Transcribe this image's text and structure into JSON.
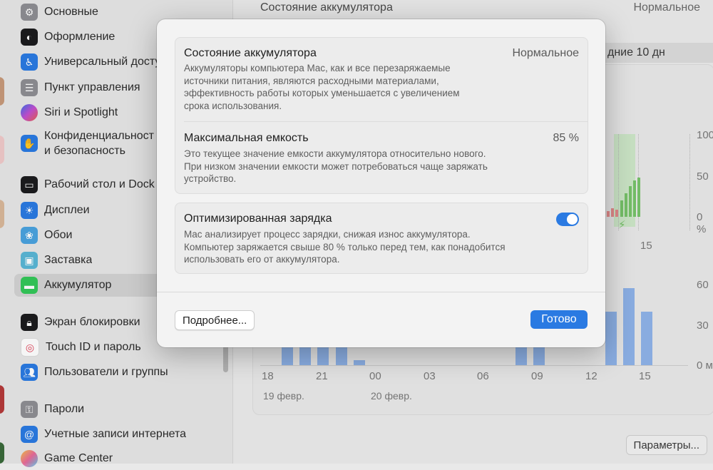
{
  "sidebar": {
    "items": [
      {
        "label": "Основные",
        "icon": "gear-icon",
        "color": "#8e8e93"
      },
      {
        "label": "Оформление",
        "icon": "appearance-icon",
        "color": "#1c1c1e"
      },
      {
        "label": "Универсальный доступ",
        "icon": "accessibility-icon",
        "color": "#2a7ae2"
      },
      {
        "label": "Пункт управления",
        "icon": "control-center-icon",
        "color": "#8e8e93"
      },
      {
        "label": "Siri и Spotlight",
        "icon": "siri-icon",
        "color": "#6a4fd1"
      },
      {
        "label": "Конфиденциальность и безопасность",
        "label_line1": "Конфиденциальност",
        "label_line2": "и безопасность",
        "icon": "hand-icon",
        "color": "#2a7ae2"
      },
      {
        "label": "Рабочий стол и Dock",
        "icon": "dock-icon",
        "color": "#1c1c1e"
      },
      {
        "label": "Дисплеи",
        "icon": "sun-icon",
        "color": "#2a7ae2"
      },
      {
        "label": "Обои",
        "icon": "flower-icon",
        "color": "#4aa3df"
      },
      {
        "label": "Заставка",
        "icon": "screensaver-icon",
        "color": "#5ab7d6"
      },
      {
        "label": "Аккумулятор",
        "icon": "battery-icon",
        "color": "#34c759"
      },
      {
        "label": "Экран блокировки",
        "icon": "lock-icon",
        "color": "#1c1c1e"
      },
      {
        "label": "Touch ID и пароль",
        "icon": "fingerprint-icon",
        "color": "#ffffff"
      },
      {
        "label": "Пользователи и группы",
        "icon": "users-icon",
        "color": "#2a7ae2"
      },
      {
        "label": "Пароли",
        "icon": "key-icon",
        "color": "#8e8e93"
      },
      {
        "label": "Учетные записи интернета",
        "icon": "at-icon",
        "color": "#2a7ae2"
      },
      {
        "label": "Game Center",
        "icon": "game-center-icon",
        "color": "#e0e0e0"
      }
    ]
  },
  "background": {
    "title": "Состояние аккумулятора",
    "status": "Нормальное",
    "tab_label": "дние 10 дн",
    "params_button": "Параметры...",
    "level_axis": [
      "100",
      "50",
      "0 %"
    ],
    "usage_axis": [
      "60",
      "30",
      "0 м"
    ],
    "level_xtick": "15",
    "usage_xticks": [
      "18",
      "21",
      "00",
      "03",
      "06",
      "09",
      "12",
      "15"
    ],
    "dates": [
      "19 февр.",
      "20 февр."
    ]
  },
  "chart_data": {
    "type": "bar",
    "categories": [
      "18",
      "21",
      "00",
      "03",
      "06",
      "09",
      "12",
      "15"
    ],
    "series": [
      {
        "values": [
          36,
          36,
          36,
          36,
          4,
          0,
          0,
          0,
          0,
          0,
          0,
          0,
          0,
          36,
          36,
          0,
          0,
          0,
          40,
          58,
          40
        ]
      }
    ],
    "ylim": [
      0,
      60
    ],
    "ylabel": ""
  },
  "modal": {
    "battery_health": {
      "title": "Состояние аккумулятора",
      "value": "Нормальное",
      "description": "Аккумуляторы компьютера Mac, как и все перезаряжаемые источники питания, являются расходными материалами, эффективность работы которых уменьшается с увеличением срока использования.",
      "desc_lines": [
        "Аккумуляторы компьютера Mac, как и все перезаряжаемые",
        "источники питания, являются расходными материалами,",
        "эффективность работы которых уменьшается с увеличением",
        "срока использования."
      ]
    },
    "max_capacity": {
      "title": "Максимальная емкость",
      "value": "85 %",
      "desc_lines": [
        "Это текущее значение емкости аккумулятора относительно нового.",
        "При низком значении емкости может потребоваться чаще заряжать",
        "устройство."
      ]
    },
    "optimized_charging": {
      "title": "Оптимизированная зарядка",
      "enabled": true,
      "desc_lines": [
        "Mac анализирует процесс зарядки, снижая износ аккумулятора.",
        "Компьютер заряжается свыше 80 % только перед тем, как понадобится",
        "использовать его от аккумулятора."
      ]
    },
    "more_button": "Подробнее...",
    "done_button": "Готово"
  }
}
